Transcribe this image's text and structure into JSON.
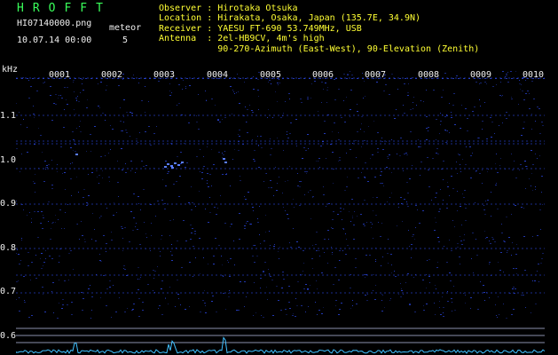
{
  "header": {
    "logo_text": "HROFFT",
    "filename": "HI07140000.png",
    "timestamp": "10.07.14 00:00",
    "meteor_label": "meteor",
    "meteor_count": "5"
  },
  "info": [
    {
      "label": "Observer ",
      "value": "Hirotaka Otsuka"
    },
    {
      "label": "Location ",
      "value": "Hirakata, Osaka, Japan (135.7E, 34.9N)"
    },
    {
      "label": "Receiver ",
      "value": "YAESU FT-690 53.749MHz, USB"
    },
    {
      "label": "Antenna  ",
      "value": "2el-HB9CV, 4m's high"
    },
    {
      "label": "         ",
      "value": "90-270-Azimuth (East-West), 90-Elevation (Zenith)"
    }
  ],
  "y_axis": {
    "unit": "kHz",
    "labels": [
      "1.1",
      "1.0",
      "0.9",
      "0.8",
      "0.7",
      "0.6"
    ]
  },
  "x_axis": {
    "labels": [
      "0001",
      "0002",
      "0003",
      "0004",
      "0005",
      "0006",
      "0007",
      "0008",
      "0009",
      "0010"
    ]
  },
  "colors": {
    "background": "#000000",
    "header_text": "#39ff5a",
    "info_text": "#ffff33",
    "axis_text": "#f0f0f0",
    "signal": "#3050ff",
    "baseline": "#9aa0c0",
    "spectrum": "#40c0ff"
  }
}
